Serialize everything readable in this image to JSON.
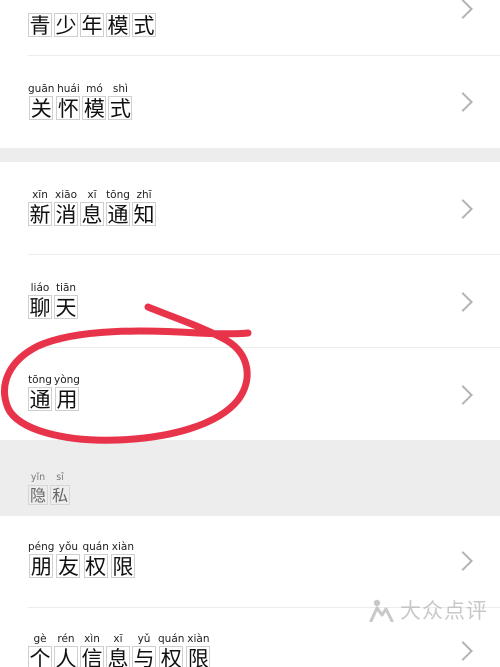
{
  "rows": [
    {
      "name": "row-teen-mode",
      "chars": [
        {
          "py": "",
          "hz": "青"
        },
        {
          "py": "",
          "hz": "少"
        },
        {
          "py": "",
          "hz": "年"
        },
        {
          "py": "",
          "hz": "模"
        },
        {
          "py": "",
          "hz": "式"
        }
      ]
    },
    {
      "name": "row-care-mode",
      "chars": [
        {
          "py": "guān",
          "hz": "关"
        },
        {
          "py": "huái",
          "hz": "怀"
        },
        {
          "py": "mó",
          "hz": "模"
        },
        {
          "py": "shì",
          "hz": "式"
        }
      ]
    },
    {
      "name": "row-new-message-notification",
      "chars": [
        {
          "py": "xīn",
          "hz": "新"
        },
        {
          "py": "xiāo",
          "hz": "消"
        },
        {
          "py": "xī",
          "hz": "息"
        },
        {
          "py": "tōng",
          "hz": "通"
        },
        {
          "py": "zhī",
          "hz": "知"
        }
      ]
    },
    {
      "name": "row-chat",
      "chars": [
        {
          "py": "liáo",
          "hz": "聊"
        },
        {
          "py": "tiān",
          "hz": "天"
        }
      ]
    },
    {
      "name": "row-general",
      "chars": [
        {
          "py": "tōng",
          "hz": "通"
        },
        {
          "py": "yòng",
          "hz": "用"
        }
      ]
    },
    {
      "name": "row-friend-permissions",
      "chars": [
        {
          "py": "péng",
          "hz": "朋"
        },
        {
          "py": "yǒu",
          "hz": "友"
        },
        {
          "py": "quán",
          "hz": "权"
        },
        {
          "py": "xiàn",
          "hz": "限"
        }
      ]
    },
    {
      "name": "row-personal-info",
      "chars": [
        {
          "py": "gè",
          "hz": "个"
        },
        {
          "py": "rén",
          "hz": "人"
        },
        {
          "py": "xìn",
          "hz": "信"
        },
        {
          "py": "xī",
          "hz": "息"
        },
        {
          "py": "yǔ",
          "hz": "与"
        },
        {
          "py": "quán",
          "hz": "权"
        },
        {
          "py": "xiàn",
          "hz": "限"
        }
      ]
    }
  ],
  "section_privacy": {
    "chars": [
      {
        "py": "yǐn",
        "hz": "隐"
      },
      {
        "py": "sī",
        "hz": "私"
      }
    ]
  },
  "annotation_color": "#e8344a",
  "watermark": {
    "text": "大众点评",
    "icon": "dianping-logo-icon"
  }
}
